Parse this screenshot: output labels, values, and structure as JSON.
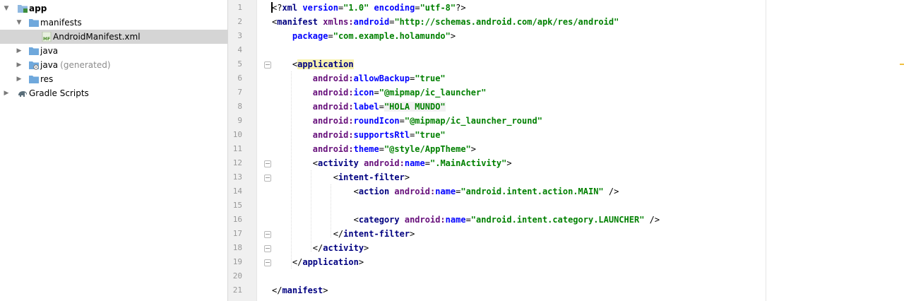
{
  "project_tree": {
    "items": [
      {
        "label": "app",
        "hint": "",
        "expanded": true,
        "icon": "module-folder-icon",
        "selected": false
      },
      {
        "label": "manifests",
        "hint": "",
        "expanded": true,
        "icon": "folder-icon",
        "selected": false
      },
      {
        "label": "AndroidManifest.xml",
        "hint": "",
        "expanded": null,
        "icon": "manifest-file-icon",
        "selected": true,
        "icon_text": "MF"
      },
      {
        "label": "java",
        "hint": "",
        "expanded": false,
        "icon": "folder-icon",
        "selected": false
      },
      {
        "label": "java",
        "hint": "(generated)",
        "expanded": false,
        "icon": "generated-folder-icon",
        "selected": false
      },
      {
        "label": "res",
        "hint": "",
        "expanded": false,
        "icon": "folder-icon",
        "selected": false
      },
      {
        "label": "Gradle Scripts",
        "hint": "",
        "expanded": false,
        "icon": "gradle-elephant-icon",
        "selected": false
      }
    ]
  },
  "editor": {
    "file": "AndroidManifest.xml",
    "current_line": 1,
    "line_numbers": [
      "1",
      "2",
      "3",
      "4",
      "5",
      "6",
      "7",
      "8",
      "9",
      "10",
      "11",
      "12",
      "13",
      "14",
      "15",
      "16",
      "17",
      "18",
      "19",
      "20",
      "21"
    ],
    "lines": [
      {
        "line": 1,
        "fold": false,
        "tokens": [
          [
            "pun",
            "<?"
          ],
          [
            "tag",
            "xml"
          ],
          [
            "attr",
            " version"
          ],
          [
            "pun",
            "="
          ],
          [
            "str",
            "\"1.0\""
          ],
          [
            "attr",
            " encoding"
          ],
          [
            "pun",
            "="
          ],
          [
            "str",
            "\"utf-8\""
          ],
          [
            "pun",
            "?>"
          ]
        ]
      },
      {
        "line": 2,
        "fold": false,
        "tokens": [
          [
            "pun",
            "<"
          ],
          [
            "tag",
            "manifest"
          ],
          [
            "pun",
            " "
          ],
          [
            "ns",
            "xmlns:"
          ],
          [
            "attr",
            "android"
          ],
          [
            "pun",
            "="
          ],
          [
            "str",
            "\"http://schemas.android.com/apk/res/android\""
          ]
        ]
      },
      {
        "line": 3,
        "fold": false,
        "tokens": [
          [
            "pun",
            "    "
          ],
          [
            "attr",
            "package"
          ],
          [
            "pun",
            "="
          ],
          [
            "str",
            "\"com.example.holamundo\""
          ],
          [
            "pun",
            ">"
          ]
        ]
      },
      {
        "line": 4,
        "fold": false,
        "tokens": []
      },
      {
        "line": 5,
        "fold": true,
        "tokens": [
          [
            "pun",
            "    <"
          ],
          [
            "tagapp",
            "application"
          ]
        ]
      },
      {
        "line": 6,
        "fold": false,
        "tokens": [
          [
            "pun",
            "        "
          ],
          [
            "ns",
            "android:"
          ],
          [
            "attr",
            "allowBackup"
          ],
          [
            "pun",
            "="
          ],
          [
            "str",
            "\"true\""
          ]
        ]
      },
      {
        "line": 7,
        "fold": false,
        "tokens": [
          [
            "pun",
            "        "
          ],
          [
            "ns",
            "android:"
          ],
          [
            "attr",
            "icon"
          ],
          [
            "pun",
            "="
          ],
          [
            "str",
            "\"@mipmap/ic_launcher\""
          ]
        ]
      },
      {
        "line": 8,
        "fold": false,
        "tokens": [
          [
            "pun",
            "        "
          ],
          [
            "ns",
            "android:"
          ],
          [
            "attr",
            "label"
          ],
          [
            "pun",
            "="
          ],
          [
            "strhl",
            "\"HOLA MUNDO\""
          ]
        ]
      },
      {
        "line": 9,
        "fold": false,
        "tokens": [
          [
            "pun",
            "        "
          ],
          [
            "ns",
            "android:"
          ],
          [
            "attr",
            "roundIcon"
          ],
          [
            "pun",
            "="
          ],
          [
            "str",
            "\"@mipmap/ic_launcher_round\""
          ]
        ]
      },
      {
        "line": 10,
        "fold": false,
        "tokens": [
          [
            "pun",
            "        "
          ],
          [
            "ns",
            "android:"
          ],
          [
            "attr",
            "supportsRtl"
          ],
          [
            "pun",
            "="
          ],
          [
            "str",
            "\"true\""
          ]
        ]
      },
      {
        "line": 11,
        "fold": false,
        "tokens": [
          [
            "pun",
            "        "
          ],
          [
            "ns",
            "android:"
          ],
          [
            "attr",
            "theme"
          ],
          [
            "pun",
            "="
          ],
          [
            "str",
            "\"@style/AppTheme\""
          ],
          [
            "pun",
            ">"
          ]
        ]
      },
      {
        "line": 12,
        "fold": true,
        "tokens": [
          [
            "pun",
            "        <"
          ],
          [
            "tag",
            "activity"
          ],
          [
            "pun",
            " "
          ],
          [
            "ns",
            "android:"
          ],
          [
            "attr",
            "name"
          ],
          [
            "pun",
            "="
          ],
          [
            "str",
            "\".MainActivity\""
          ],
          [
            "pun",
            ">"
          ]
        ]
      },
      {
        "line": 13,
        "fold": true,
        "tokens": [
          [
            "pun",
            "            <"
          ],
          [
            "tag",
            "intent-filter"
          ],
          [
            "pun",
            ">"
          ]
        ]
      },
      {
        "line": 14,
        "fold": false,
        "tokens": [
          [
            "pun",
            "                <"
          ],
          [
            "tag",
            "action"
          ],
          [
            "pun",
            " "
          ],
          [
            "ns",
            "android:"
          ],
          [
            "attr",
            "name"
          ],
          [
            "pun",
            "="
          ],
          [
            "str",
            "\"android.intent.action.MAIN\""
          ],
          [
            "pun",
            " />"
          ]
        ]
      },
      {
        "line": 15,
        "fold": false,
        "tokens": []
      },
      {
        "line": 16,
        "fold": false,
        "tokens": [
          [
            "pun",
            "                <"
          ],
          [
            "tag",
            "category"
          ],
          [
            "pun",
            " "
          ],
          [
            "ns",
            "android:"
          ],
          [
            "attr",
            "name"
          ],
          [
            "pun",
            "="
          ],
          [
            "str",
            "\"android.intent.category.LAUNCHER\""
          ],
          [
            "pun",
            " />"
          ]
        ]
      },
      {
        "line": 17,
        "fold": true,
        "tokens": [
          [
            "pun",
            "            </"
          ],
          [
            "tag",
            "intent-filter"
          ],
          [
            "pun",
            ">"
          ]
        ]
      },
      {
        "line": 18,
        "fold": true,
        "tokens": [
          [
            "pun",
            "        </"
          ],
          [
            "tag",
            "activity"
          ],
          [
            "pun",
            ">"
          ]
        ]
      },
      {
        "line": 19,
        "fold": true,
        "tokens": [
          [
            "pun",
            "    </"
          ],
          [
            "tag",
            "application"
          ],
          [
            "pun",
            ">"
          ]
        ]
      },
      {
        "line": 20,
        "fold": false,
        "tokens": []
      },
      {
        "line": 21,
        "fold": false,
        "tokens": [
          [
            "pun",
            "</"
          ],
          [
            "tag",
            "manifest"
          ],
          [
            "pun",
            ">"
          ]
        ]
      }
    ]
  },
  "colors": {
    "tag": "#000080",
    "namespace": "#660e7a",
    "attribute": "#0000ff",
    "string": "#008000",
    "current_line": "#fffae3",
    "gutter": "#f0f0f0",
    "selection": "#d5d5d5",
    "folder": "#6fa8dc"
  }
}
